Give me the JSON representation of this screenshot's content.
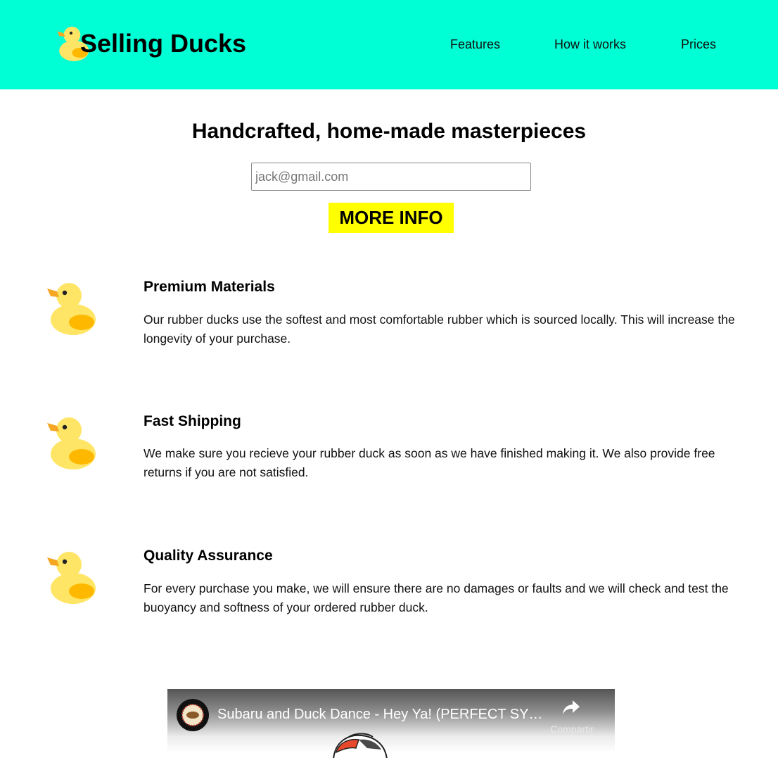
{
  "header": {
    "brand": "Selling Ducks",
    "logo_icon": "rubber-duck-icon",
    "nav": [
      {
        "label": "Features"
      },
      {
        "label": "How it works"
      },
      {
        "label": "Prices"
      }
    ]
  },
  "hero": {
    "title": "Handcrafted, home-made masterpieces",
    "email_placeholder": "jack@gmail.com",
    "button_label": "MORE INFO"
  },
  "features": [
    {
      "icon": "rubber-duck-icon",
      "title": "Premium Materials",
      "text": "Our rubber ducks use the softest and most comfortable rubber which is sourced locally. This will increase the longevity of your purchase."
    },
    {
      "icon": "rubber-duck-icon",
      "title": "Fast Shipping",
      "text": "We make sure you recieve your rubber duck as soon as we have finished making it. We also provide free returns if you are not satisfied."
    },
    {
      "icon": "rubber-duck-icon",
      "title": "Quality Assurance",
      "text": "For every purchase you make, we will ensure there are no damages or faults and we will check and test the buoyancy and softness of your ordered rubber duck."
    }
  ],
  "video": {
    "title": "Subaru and Duck Dance - Hey Ya! (PERFECT SYN...",
    "share_label": "Compartir",
    "share_icon": "share-arrow-icon"
  },
  "colors": {
    "header_bg": "#00ffd5",
    "button_bg": "#ffff00",
    "duck_light": "#ffe566",
    "duck_dark": "#ffb800",
    "beak": "#f5a623"
  }
}
